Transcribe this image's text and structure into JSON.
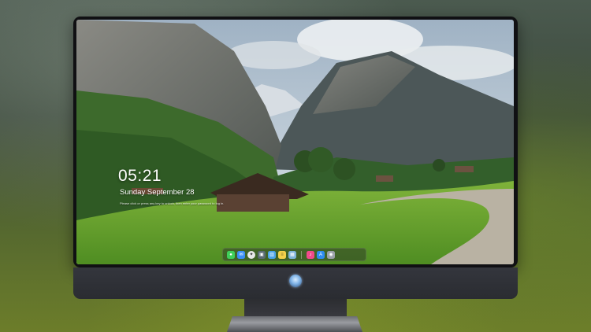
{
  "lockscreen": {
    "time": "05:21",
    "date": "Sunday September  28",
    "hint": "Please click or press any key to unlock, then enter your password to log in."
  },
  "dock": {
    "icons": [
      {
        "name": "messages-icon",
        "color": "#3fcf5a"
      },
      {
        "name": "mail-icon",
        "color": "#3a8ef5"
      },
      {
        "name": "safari-icon",
        "color": "#e8e8e8"
      },
      {
        "name": "terminal-icon",
        "color": "#5b6b74"
      },
      {
        "name": "calendar-icon",
        "color": "#4aa3e8"
      },
      {
        "name": "notes-icon",
        "color": "#f3d14a"
      },
      {
        "name": "preview-icon",
        "color": "#7fb5d9"
      },
      {
        "name": "music-icon",
        "color": "#f04a8a"
      },
      {
        "name": "app-store-icon",
        "color": "#2d8cf0"
      },
      {
        "name": "camera-icon",
        "color": "#9aa0a6"
      }
    ]
  },
  "colors": {
    "frame": "#101013",
    "chin": "#2e3035",
    "grass": "#5f9b2c",
    "sky": "#b9c9d6"
  }
}
